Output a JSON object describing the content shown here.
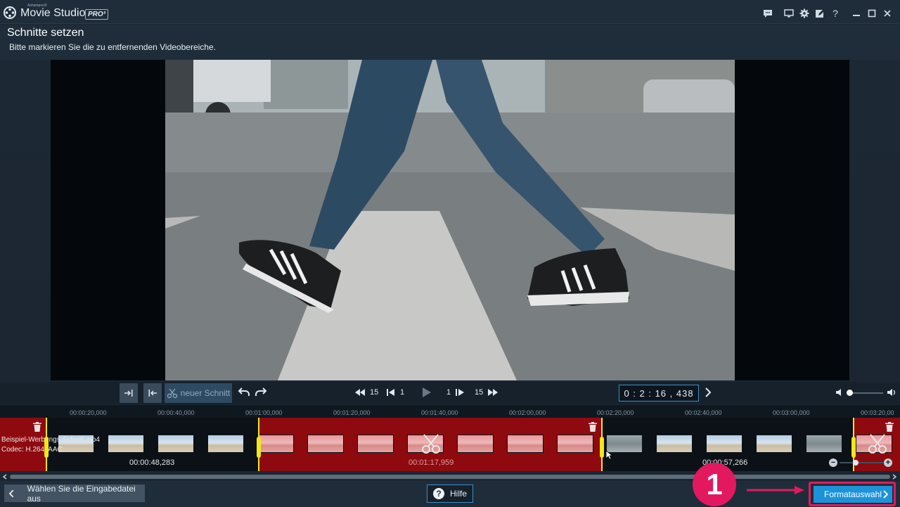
{
  "app": {
    "maker": "Ashampoo®",
    "name": "Movie Studio",
    "edition": "PRO³"
  },
  "header": {
    "title": "Schnitte setzen",
    "subtitle": "Bitte markieren Sie die zu entfernenden Videobereiche."
  },
  "controls": {
    "new_cut_label": "neuer Schnitt",
    "skip_back_value": "15",
    "frame_back_value": "1",
    "frame_forward_value": "1",
    "skip_forward_value": "15",
    "timecode": "0 : 2 : 16 , 438"
  },
  "ruler": {
    "labels": [
      "00:00:20,000",
      "00:00:40,000",
      "00:01:00,000",
      "00:01:20,000",
      "00:01:40,000",
      "00:02:00,000",
      "00:02:20,000",
      "00:02:40,000",
      "00:03:00,000",
      "00:03:20,00"
    ]
  },
  "track": {
    "file_name": "Beispiel-Werbungs-Schnitt.mp4",
    "codec": "Codec: H.264, AAC",
    "segment_times": [
      "00:00:48,283",
      "00:01:17,959",
      "00:00:57,266"
    ]
  },
  "footer": {
    "back_label": "Wählen Sie die Eingabedatei aus",
    "help_label": "Hilfe",
    "next_label": "Formatauswahl"
  },
  "annotation": {
    "step_number": "1"
  },
  "colors": {
    "accent": "#1c93d8",
    "cut_region": "#8e0a0f",
    "marker": "#f2e71a",
    "annotation": "#e3195f"
  }
}
